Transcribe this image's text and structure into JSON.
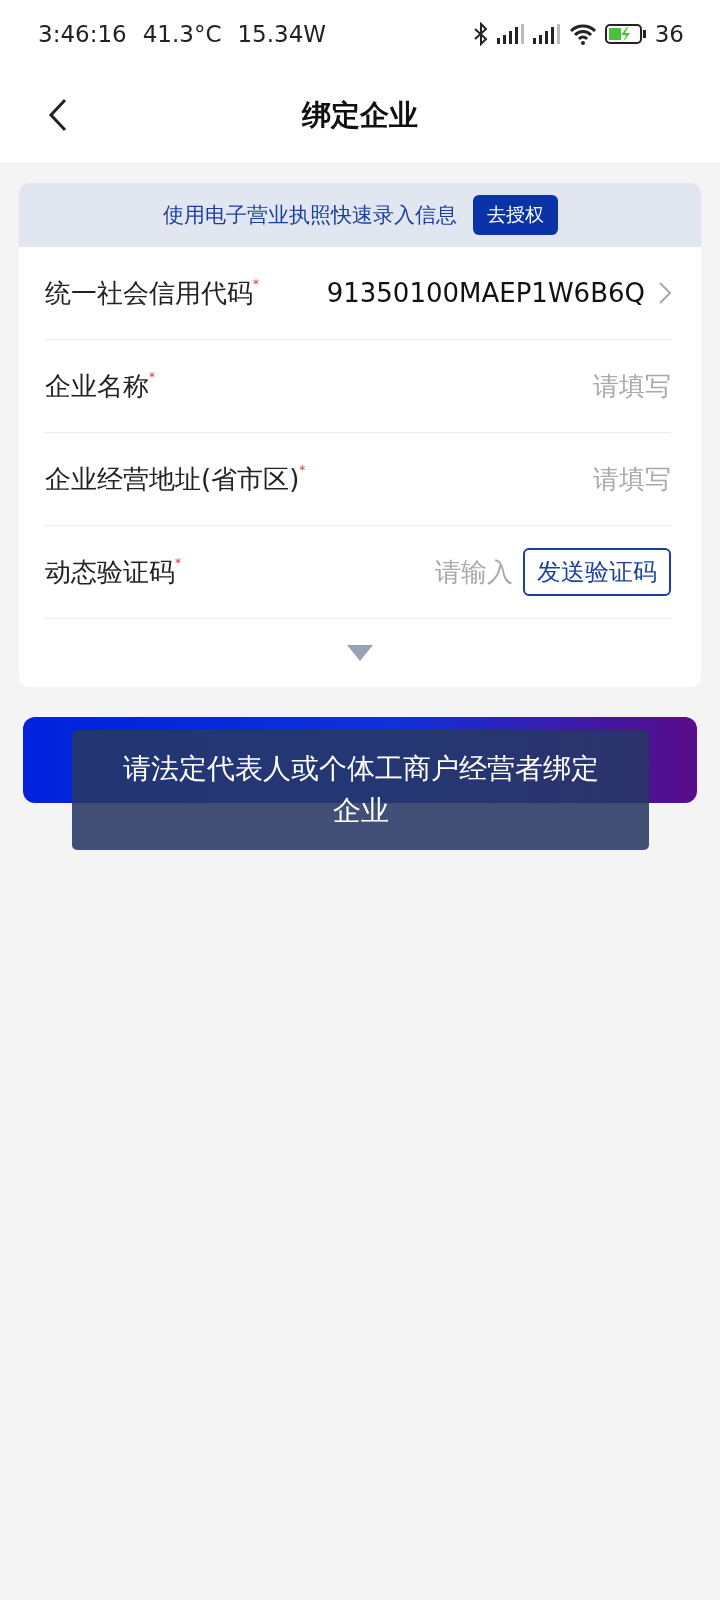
{
  "status_bar": {
    "time": "3:46:16",
    "temperature": "41.3°C",
    "power": "15.34W",
    "battery": "36"
  },
  "header": {
    "title": "绑定企业"
  },
  "banner": {
    "text": "使用电子营业执照快速录入信息",
    "button": "去授权"
  },
  "rows": [
    {
      "kind": "select",
      "label": "统一社会信用代码",
      "mark": "*",
      "value": "91350100MAEP1W6B6Q"
    },
    {
      "kind": "text",
      "label": "企业名称",
      "mark": "*",
      "placeholder": "请填写"
    },
    {
      "kind": "text",
      "label": "企业经营地址(省市区)",
      "mark": "*",
      "placeholder": "请填写"
    },
    {
      "kind": "code",
      "label": "动态验证码",
      "mark": "*",
      "placeholder": "请输入",
      "button": "发送验证码"
    }
  ],
  "expanded": false,
  "toast": "请法定代表人或个体工商户经营者绑定企业"
}
